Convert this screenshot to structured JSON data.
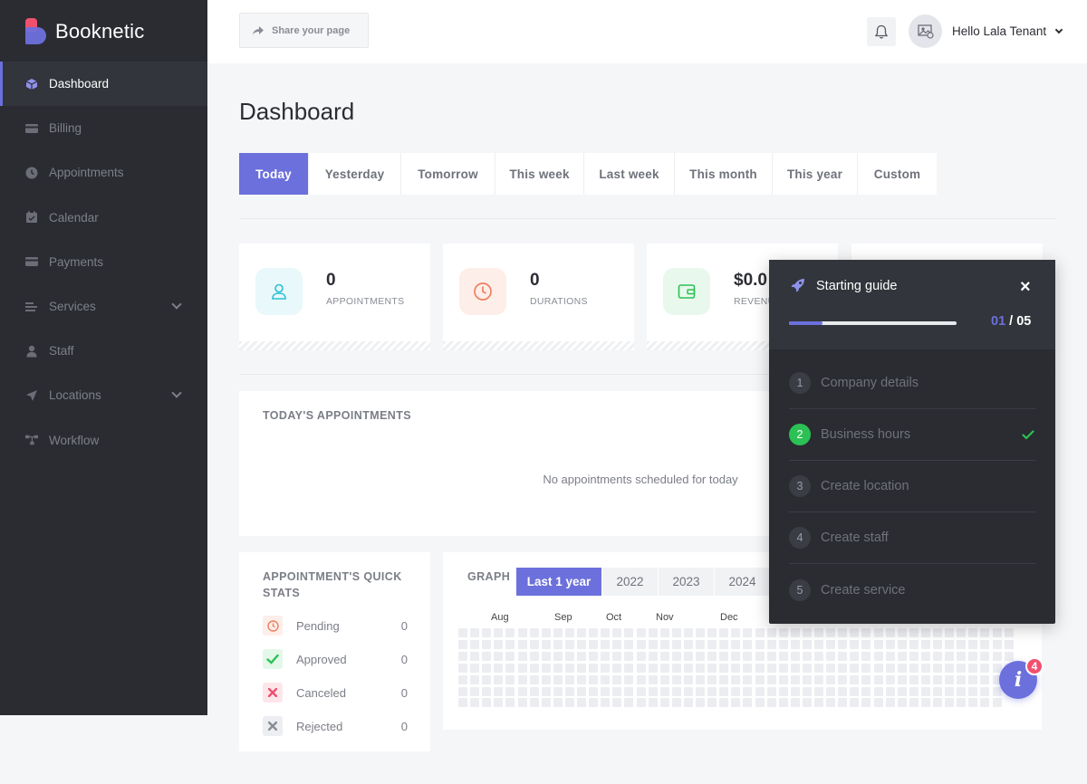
{
  "app": {
    "name": "Booknetic"
  },
  "sidebar": {
    "items": [
      {
        "label": "Dashboard",
        "icon": "cube-icon",
        "active": true
      },
      {
        "label": "Billing",
        "icon": "credit-card-icon"
      },
      {
        "label": "Appointments",
        "icon": "clock-icon"
      },
      {
        "label": "Calendar",
        "icon": "calendar-icon"
      },
      {
        "label": "Payments",
        "icon": "credit-card-icon"
      },
      {
        "label": "Services",
        "icon": "list-icon",
        "has_submenu": true
      },
      {
        "label": "Staff",
        "icon": "user-icon"
      },
      {
        "label": "Locations",
        "icon": "location-arrow-icon",
        "has_submenu": true
      },
      {
        "label": "Workflow",
        "icon": "workflow-icon"
      }
    ]
  },
  "topbar": {
    "share_label": "Share your page",
    "user_greeting": "Hello Lala Tenant"
  },
  "main": {
    "title": "Dashboard",
    "tabs": [
      "Today",
      "Yesterday",
      "Tomorrow",
      "This week",
      "Last week",
      "This month",
      "This year",
      "Custom"
    ],
    "active_tab": "Today",
    "stats": [
      {
        "value": "0",
        "label": "APPOINTMENTS",
        "icon": "user-icon",
        "color": "#2bc0d5",
        "bg": "#e8f8fb"
      },
      {
        "value": "0",
        "label": "DURATIONS",
        "icon": "clock-icon",
        "color": "#f0805e",
        "bg": "#fdeee9"
      },
      {
        "value": "$0.0",
        "label": "REVENU",
        "icon": "wallet-icon",
        "color": "#2bc155",
        "bg": "#e8f8ec"
      }
    ],
    "today": {
      "title": "TODAY'S APPOINTMENTS",
      "empty_text": "No appointments scheduled for today"
    },
    "quick_stats": {
      "title": "APPOINTMENT'S QUICK STATS",
      "rows": [
        {
          "label": "Pending",
          "value": "0",
          "icon": "clock-icon",
          "color": "#f0805e",
          "bg": "#fdeee9"
        },
        {
          "label": "Approved",
          "value": "0",
          "icon": "check-icon",
          "color": "#2bc155",
          "bg": "#e3f8e8"
        },
        {
          "label": "Canceled",
          "value": "0",
          "icon": "x-icon",
          "color": "#f0506e",
          "bg": "#fde6ea"
        },
        {
          "label": "Rejected",
          "value": "0",
          "icon": "x-icon",
          "color": "#8a8d96",
          "bg": "#eceef1"
        }
      ]
    },
    "graph": {
      "title": "GRAPH",
      "tabs": [
        "Last 1 year",
        "2022",
        "2023",
        "2024"
      ],
      "active_tab": "Last 1 year",
      "months": [
        "Aug",
        "Sep",
        "Oct",
        "Nov",
        "Dec"
      ]
    }
  },
  "guide": {
    "title": "Starting guide",
    "close_label": "×",
    "current": "01",
    "total": "05",
    "progress": 0.2,
    "steps": [
      {
        "num": "1",
        "label": "Company details",
        "done": false
      },
      {
        "num": "2",
        "label": "Business hours",
        "done": true
      },
      {
        "num": "3",
        "label": "Create location",
        "done": false
      },
      {
        "num": "4",
        "label": "Create staff",
        "done": false
      },
      {
        "num": "5",
        "label": "Create service",
        "done": false
      }
    ]
  },
  "help": {
    "icon_label": "i",
    "badge": "4"
  },
  "colors": {
    "accent": "#6c70dc",
    "sidebar_bg": "#2a2c31",
    "success": "#2bc155",
    "danger": "#f0506e"
  }
}
